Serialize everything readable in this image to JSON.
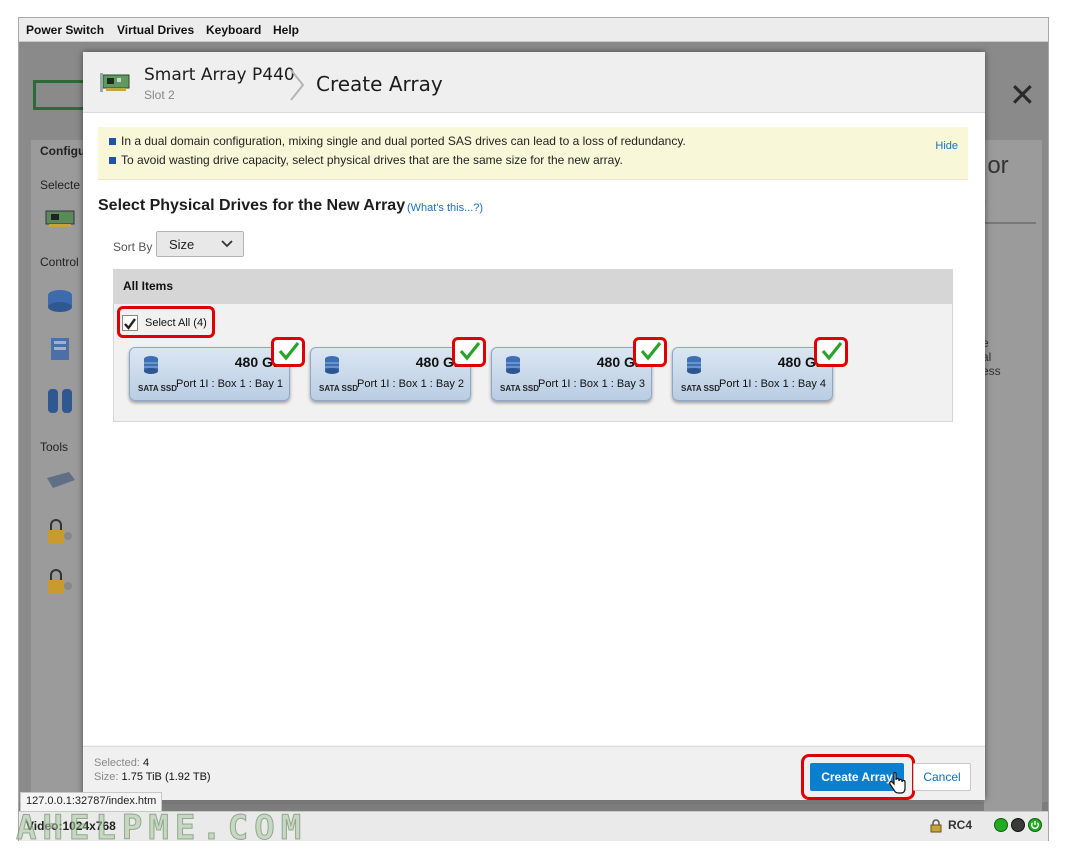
{
  "menubar": {
    "items": [
      "Power Switch",
      "Virtual Drives",
      "Keyboard",
      "Help"
    ]
  },
  "background": {
    "sidebar": {
      "heading": "Configu",
      "selected": "Selecte",
      "controllers": "Control",
      "tools": "Tools"
    },
    "right": {
      "title": "t or",
      "subtitle": "r.",
      "line1": "e",
      "line2": "al",
      "line3": "ess"
    }
  },
  "dialog": {
    "header": {
      "title": "Smart Array P440",
      "subtitle": "Slot 2",
      "page": "Create Array"
    },
    "notice": {
      "lines": [
        "In a dual domain configuration, mixing single and dual ported SAS drives can lead to a loss of redundancy.",
        "To avoid wasting drive capacity, select physical drives that are the same size for the new array."
      ],
      "hide": "Hide"
    },
    "section_title": "Select Physical Drives for the New Array",
    "whats_this": "(What's this...?)",
    "sort": {
      "label": "Sort By",
      "value": "Size"
    },
    "items": {
      "heading": "All Items",
      "select_all": "Select All (4)",
      "drives": [
        {
          "size": "480 GB",
          "type": "SATA SSD",
          "location": "Port 1I : Box 1 : Bay 1"
        },
        {
          "size": "480 GB",
          "type": "SATA SSD",
          "location": "Port 1I : Box 1 : Bay 2"
        },
        {
          "size": "480 GB",
          "type": "SATA SSD",
          "location": "Port 1I : Box 1 : Bay 3"
        },
        {
          "size": "480 GB",
          "type": "SATA SSD",
          "location": "Port 1I : Box 1 : Bay 4"
        }
      ]
    },
    "footer": {
      "selected_label": "Selected:",
      "selected_value": "4",
      "size_label": "Size:",
      "size_value": "1.75 TiB (1.92 TB)",
      "create_label": "Create Array",
      "cancel_label": "Cancel"
    }
  },
  "status_url": "127.0.0.1:32787/index.htm",
  "statusbar": {
    "video": "Video:1024x768",
    "encryption": "RC4"
  },
  "watermark": "AHELPME.COM",
  "colors": {
    "accent": "#0a7fcf",
    "highlight": "#e00000",
    "notice_bg": "#f8f8d9",
    "led_green": "#22aa22"
  }
}
